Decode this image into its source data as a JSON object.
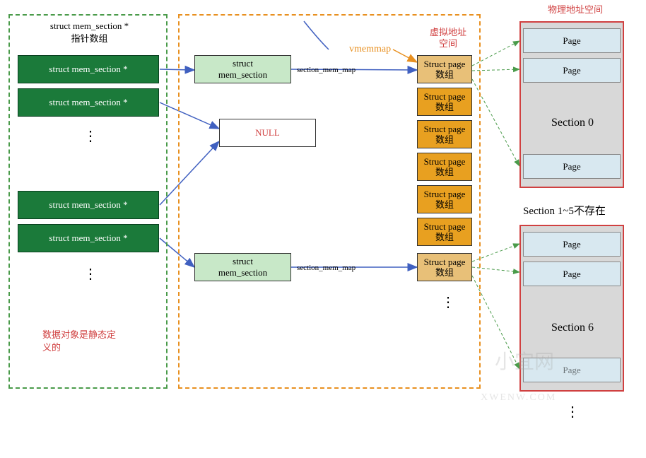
{
  "left_panel": {
    "title1": "struct mem_section *",
    "title2": "指针数组",
    "items": [
      "struct mem_section *",
      "struct mem_section *",
      "struct mem_section *",
      "struct mem_section *"
    ],
    "footer": "数据对象是静态定\n义的"
  },
  "mid_panel": {
    "vmemmap": "vmemmap",
    "section_mem_map": "section_mem_map",
    "virt_label": "虚拟地址\n空间",
    "struct_sec": "struct\nmem_section",
    "null_label": "NULL",
    "struct_page": "Struct page\n数组"
  },
  "right_panel": {
    "title": "物理地址空间",
    "page": "Page",
    "sec0": "Section 0",
    "sec15": "Section 1~5不存在",
    "sec6": "Section 6"
  },
  "watermark": {
    "main": "小宜网",
    "sub": "XWENW.COM"
  }
}
